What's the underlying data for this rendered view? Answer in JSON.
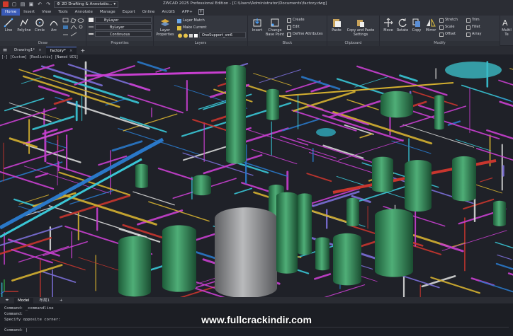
{
  "titlebar": {
    "workspace": "2D Drafting & Annotatio...",
    "title": "ZWCAD 2025 Professional Edition - [C:\\Users\\Administrator\\Documents\\factory.dwg]"
  },
  "menu": {
    "items": [
      "Home",
      "Insert",
      "View",
      "Tools",
      "Annotate",
      "Manage",
      "Export",
      "Online",
      "ArcGIS",
      "APP+"
    ],
    "active": "Home",
    "add_label": "+"
  },
  "ribbon": {
    "draw": {
      "title": "Draw",
      "tools": [
        "Line",
        "Polyline",
        "Circle",
        "Arc"
      ]
    },
    "properties": {
      "title": "Properties",
      "color": "ByLayer",
      "linetype": "ByLayer",
      "lineweight": "Continuous"
    },
    "layers": {
      "title": "Layers",
      "layer_properties": "Layer Properties",
      "layer_match": "Layer Match",
      "make_current": "Make Current",
      "current_layer": "OneSupport_sm6"
    },
    "block": {
      "title": "Block",
      "insert": "Insert",
      "change_base_point": "Change Base Point",
      "create": "Create",
      "edit": "Edit",
      "define_attributes": "Define Attributes"
    },
    "clipboard": {
      "title": "Clipboard",
      "paste": "Paste",
      "copy_paste_settings": "Copy and Paste Settings"
    },
    "modify": {
      "title": "Modify",
      "move": "Move",
      "rotate": "Rotate",
      "copy": "Copy",
      "mirror": "Mirror",
      "stretch": "Stretch",
      "scale": "Scale",
      "offset": "Offset",
      "trim": "Trim",
      "fillet": "Fillet",
      "array": "Array",
      "multiline": "Multil Te"
    }
  },
  "doctabs": {
    "tabs": [
      "Drawing1*",
      "factory*"
    ],
    "active": "factory*",
    "close": "×",
    "add": "+"
  },
  "viewport": {
    "view_label": "[-] [Custom] [Realistic] [Named UCS]"
  },
  "layouts": {
    "tabs": [
      "Model",
      "布局1"
    ],
    "active": "Model",
    "add": "+"
  },
  "command": {
    "history": [
      "Command: _commandline",
      "Command:",
      "Specify opposite corner:"
    ],
    "prompt": "Command:"
  },
  "watermark": "www.fullcrackindir.com",
  "colors": {
    "accent": "#3a5bb8",
    "vessel_green": "#2f8a57",
    "tank_gray": "#8c8d8f",
    "pipe_magenta": "#c83fd0",
    "pipe_blue": "#2a78c8",
    "pipe_cyan": "#39c7d6",
    "pipe_red": "#c8362e",
    "pipe_yellow": "#d4b030"
  }
}
